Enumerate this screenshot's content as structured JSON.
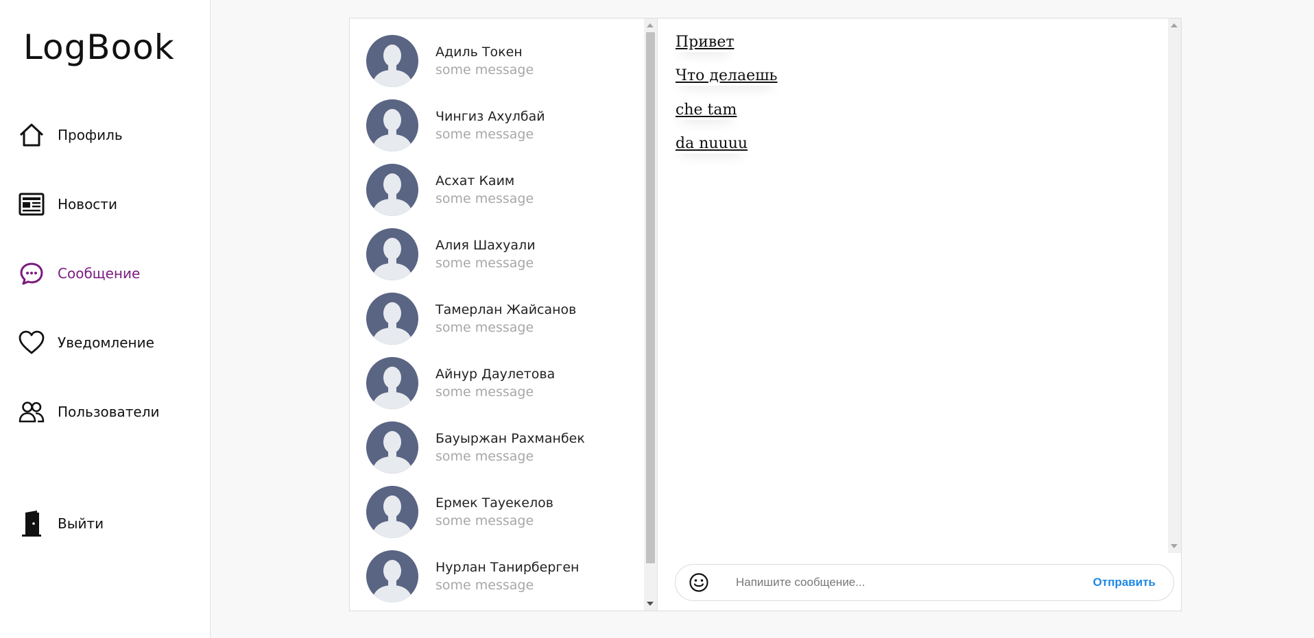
{
  "sidebar": {
    "logo": "LogBook",
    "items": [
      {
        "label": "Профиль",
        "icon": "home-icon"
      },
      {
        "label": "Новости",
        "icon": "newspaper-icon"
      },
      {
        "label": "Сообщение",
        "icon": "chat-bubble-icon",
        "active": true
      },
      {
        "label": "Уведомление",
        "icon": "heart-icon"
      },
      {
        "label": "Пользователи",
        "icon": "users-icon"
      }
    ],
    "logout_label": "Выйти",
    "logout_icon": "door-icon",
    "active_color": "#7b1a7e"
  },
  "contacts": [
    {
      "name": "Адиль Токен",
      "preview": "some message"
    },
    {
      "name": "Чингиз Ахулбай",
      "preview": "some message"
    },
    {
      "name": "Асхат Каим",
      "preview": "some message"
    },
    {
      "name": "Алия Шахуали",
      "preview": "some message"
    },
    {
      "name": "Тамерлан Жайсанов",
      "preview": "some message"
    },
    {
      "name": "Айнур Даулетова",
      "preview": "some message"
    },
    {
      "name": "Бауыржан Рахманбек",
      "preview": "some message"
    },
    {
      "name": "Ермек Тауекелов",
      "preview": "some message"
    },
    {
      "name": "Нурлан Танирберген",
      "preview": "some message"
    }
  ],
  "messages": [
    "Привет",
    "Что делаешь",
    "che tam",
    "da nuuuu"
  ],
  "composer": {
    "placeholder": "Напишите сообщение...",
    "value": "",
    "send_label": "Отправить",
    "emoji_icon": "smiley-icon",
    "send_color": "#1e88e5"
  }
}
